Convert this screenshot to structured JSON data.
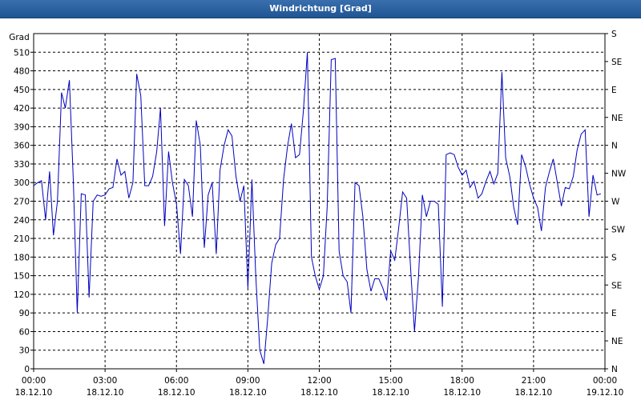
{
  "window": {
    "title": "Windrichtung [Grad]"
  },
  "chart_data": {
    "type": "line",
    "title": "Windrichtung [Grad]",
    "ylabel": "Grad",
    "xlabel": "",
    "ylim": [
      0,
      540
    ],
    "xlim": [
      0,
      24
    ],
    "grid": true,
    "y_ticks": [
      0,
      30,
      60,
      90,
      120,
      150,
      180,
      210,
      240,
      270,
      300,
      330,
      360,
      390,
      420,
      450,
      480,
      510
    ],
    "x_ticks": [
      {
        "x": 0,
        "time": "00:00",
        "date": "18.12.10"
      },
      {
        "x": 3,
        "time": "03:00",
        "date": "18.12.10"
      },
      {
        "x": 6,
        "time": "06:00",
        "date": "18.12.10"
      },
      {
        "x": 9,
        "time": "09:00",
        "date": "18.12.10"
      },
      {
        "x": 12,
        "time": "12:00",
        "date": "18.12.10"
      },
      {
        "x": 15,
        "time": "15:00",
        "date": "18.12.10"
      },
      {
        "x": 18,
        "time": "18:00",
        "date": "18.12.10"
      },
      {
        "x": 21,
        "time": "21:00",
        "date": "18.12.10"
      },
      {
        "x": 24,
        "time": "00:00",
        "date": "19.12.10"
      }
    ],
    "right_axis": [
      {
        "value": 0,
        "label": "N"
      },
      {
        "value": 45,
        "label": "NE"
      },
      {
        "value": 90,
        "label": "E"
      },
      {
        "value": 135,
        "label": "SE"
      },
      {
        "value": 180,
        "label": "S"
      },
      {
        "value": 225,
        "label": "SW"
      },
      {
        "value": 270,
        "label": "W"
      },
      {
        "value": 315,
        "label": "NW"
      },
      {
        "value": 360,
        "label": "N"
      },
      {
        "value": 405,
        "label": "NE"
      },
      {
        "value": 450,
        "label": "E"
      },
      {
        "value": 495,
        "label": "SE"
      },
      {
        "value": 540,
        "label": "S"
      }
    ],
    "series": [
      {
        "color": "#0000c0",
        "points": [
          [
            0.0,
            295
          ],
          [
            0.17,
            300
          ],
          [
            0.33,
            303
          ],
          [
            0.5,
            240
          ],
          [
            0.67,
            318
          ],
          [
            0.83,
            215
          ],
          [
            1.0,
            270
          ],
          [
            1.17,
            445
          ],
          [
            1.33,
            420
          ],
          [
            1.5,
            465
          ],
          [
            1.67,
            300
          ],
          [
            1.83,
            90
          ],
          [
            2.0,
            282
          ],
          [
            2.17,
            280
          ],
          [
            2.33,
            115
          ],
          [
            2.5,
            270
          ],
          [
            2.67,
            280
          ],
          [
            2.83,
            278
          ],
          [
            3.0,
            280
          ],
          [
            3.17,
            290
          ],
          [
            3.33,
            292
          ],
          [
            3.5,
            338
          ],
          [
            3.67,
            312
          ],
          [
            3.83,
            318
          ],
          [
            4.0,
            275
          ],
          [
            4.17,
            300
          ],
          [
            4.33,
            475
          ],
          [
            4.5,
            440
          ],
          [
            4.67,
            295
          ],
          [
            4.83,
            295
          ],
          [
            5.0,
            310
          ],
          [
            5.17,
            350
          ],
          [
            5.33,
            420
          ],
          [
            5.5,
            230
          ],
          [
            5.67,
            350
          ],
          [
            5.83,
            300
          ],
          [
            6.0,
            265
          ],
          [
            6.17,
            185
          ],
          [
            6.33,
            305
          ],
          [
            6.5,
            295
          ],
          [
            6.67,
            245
          ],
          [
            6.83,
            400
          ],
          [
            7.0,
            360
          ],
          [
            7.17,
            195
          ],
          [
            7.33,
            280
          ],
          [
            7.5,
            300
          ],
          [
            7.67,
            185
          ],
          [
            7.83,
            320
          ],
          [
            8.0,
            360
          ],
          [
            8.17,
            385
          ],
          [
            8.33,
            375
          ],
          [
            8.5,
            310
          ],
          [
            8.67,
            270
          ],
          [
            8.83,
            295
          ],
          [
            9.0,
            130
          ],
          [
            9.17,
            305
          ],
          [
            9.33,
            150
          ],
          [
            9.5,
            30
          ],
          [
            9.67,
            8
          ],
          [
            9.83,
            80
          ],
          [
            10.0,
            170
          ],
          [
            10.17,
            200
          ],
          [
            10.33,
            210
          ],
          [
            10.5,
            305
          ],
          [
            10.67,
            360
          ],
          [
            10.83,
            395
          ],
          [
            11.0,
            340
          ],
          [
            11.17,
            345
          ],
          [
            11.33,
            415
          ],
          [
            11.5,
            510
          ],
          [
            11.67,
            180
          ],
          [
            11.83,
            150
          ],
          [
            12.0,
            128
          ],
          [
            12.17,
            150
          ],
          [
            12.33,
            260
          ],
          [
            12.5,
            498
          ],
          [
            12.67,
            500
          ],
          [
            12.83,
            190
          ],
          [
            13.0,
            150
          ],
          [
            13.17,
            140
          ],
          [
            13.33,
            90
          ],
          [
            13.5,
            300
          ],
          [
            13.67,
            295
          ],
          [
            13.83,
            245
          ],
          [
            14.0,
            160
          ],
          [
            14.17,
            125
          ],
          [
            14.33,
            145
          ],
          [
            14.5,
            145
          ],
          [
            14.67,
            130
          ],
          [
            14.83,
            110
          ],
          [
            15.0,
            190
          ],
          [
            15.17,
            175
          ],
          [
            15.33,
            225
          ],
          [
            15.5,
            285
          ],
          [
            15.67,
            275
          ],
          [
            15.83,
            165
          ],
          [
            16.0,
            60
          ],
          [
            16.17,
            150
          ],
          [
            16.33,
            280
          ],
          [
            16.5,
            245
          ],
          [
            16.67,
            270
          ],
          [
            16.83,
            270
          ],
          [
            17.0,
            265
          ],
          [
            17.17,
            100
          ],
          [
            17.33,
            345
          ],
          [
            17.5,
            348
          ],
          [
            17.67,
            345
          ],
          [
            17.83,
            325
          ],
          [
            18.0,
            312
          ],
          [
            18.17,
            320
          ],
          [
            18.33,
            292
          ],
          [
            18.5,
            302
          ],
          [
            18.67,
            275
          ],
          [
            18.83,
            282
          ],
          [
            19.0,
            302
          ],
          [
            19.17,
            318
          ],
          [
            19.33,
            298
          ],
          [
            19.5,
            315
          ],
          [
            19.67,
            478
          ],
          [
            19.83,
            340
          ],
          [
            20.0,
            310
          ],
          [
            20.17,
            260
          ],
          [
            20.33,
            232
          ],
          [
            20.5,
            345
          ],
          [
            20.67,
            325
          ],
          [
            20.83,
            298
          ],
          [
            21.0,
            275
          ],
          [
            21.17,
            260
          ],
          [
            21.33,
            222
          ],
          [
            21.5,
            292
          ],
          [
            21.67,
            318
          ],
          [
            21.83,
            338
          ],
          [
            22.0,
            300
          ],
          [
            22.17,
            262
          ],
          [
            22.33,
            292
          ],
          [
            22.5,
            290
          ],
          [
            22.67,
            310
          ],
          [
            22.83,
            352
          ],
          [
            23.0,
            378
          ],
          [
            23.17,
            385
          ],
          [
            23.33,
            245
          ],
          [
            23.5,
            312
          ],
          [
            23.67,
            280
          ],
          [
            23.83,
            282
          ]
        ]
      }
    ]
  }
}
